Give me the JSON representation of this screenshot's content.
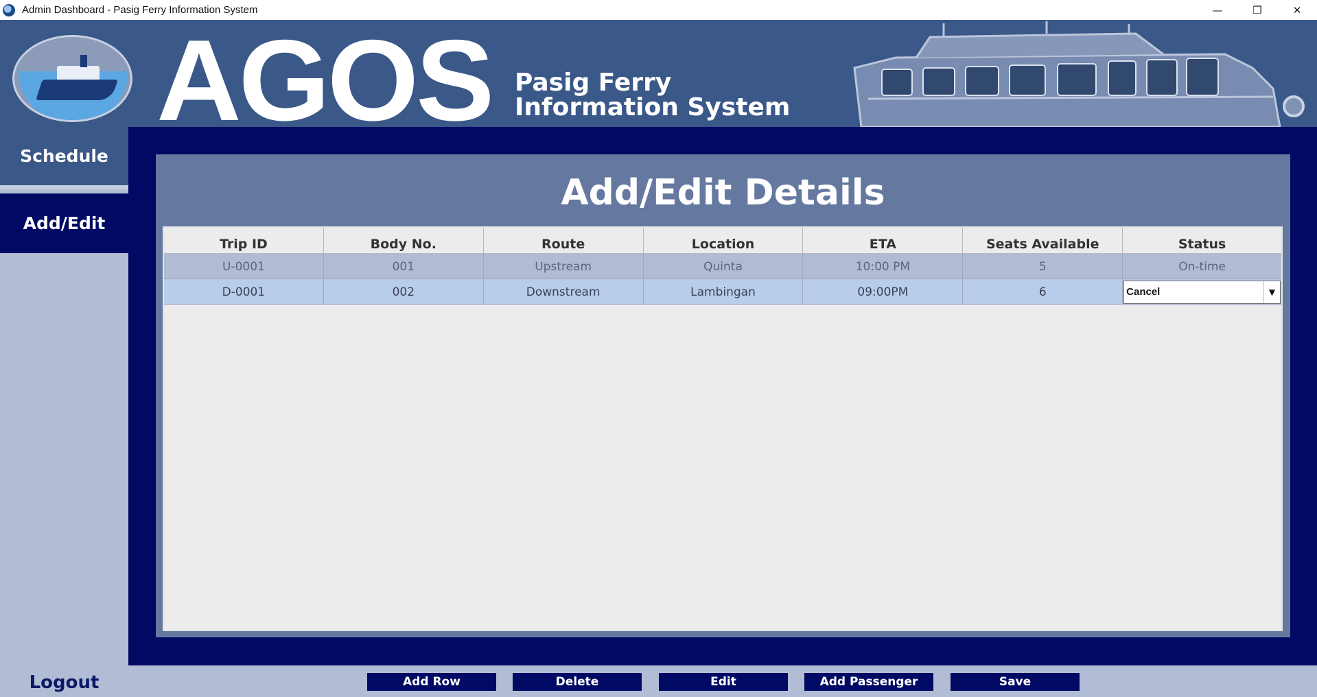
{
  "window": {
    "title": "Admin Dashboard - Pasig Ferry Information System",
    "minimize": "—",
    "restore": "❐",
    "close": "✕"
  },
  "header": {
    "brand": "AGOS",
    "subtitle_line1": "Pasig Ferry",
    "subtitle_line2": "Information System"
  },
  "sidebar": {
    "items": [
      {
        "label": "Schedule"
      },
      {
        "label": "Add/Edit",
        "active": true
      }
    ],
    "logout": "Logout"
  },
  "main": {
    "title": "Add/Edit Details",
    "table": {
      "columns": [
        "Trip ID",
        "Body No.",
        "Route",
        "Location",
        "ETA",
        "Seats Available",
        "Status"
      ],
      "rows": [
        [
          "U-0001",
          "001",
          "Upstream",
          "Quinta",
          "10:00 PM",
          "5",
          "On-time"
        ],
        [
          "D-0001",
          "002",
          "Downstream",
          "Lambingan",
          "09:00PM",
          "6",
          "Cancel"
        ]
      ]
    }
  },
  "buttons": {
    "add_row": "Add Row",
    "delete": "Delete",
    "edit": "Edit",
    "add_passenger": "Add Passenger",
    "save": "Save"
  },
  "colors": {
    "banner": "#3a5888",
    "navy": "#000a64",
    "card": "#6578a0",
    "sidebar": "#b3bcd5"
  }
}
